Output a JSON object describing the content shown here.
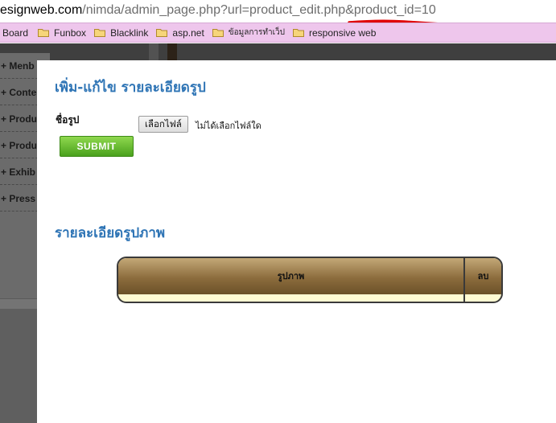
{
  "browser": {
    "url_host": "esignweb.com",
    "url_path": "/nimda/admin_page.php?url=product_edit.php&",
    "url_highlight": "product_id=10",
    "bookmarks": [
      {
        "label": "Board",
        "icon": "none"
      },
      {
        "label": "Funbox",
        "icon": "folder-icon"
      },
      {
        "label": "Blacklink",
        "icon": "folder-icon"
      },
      {
        "label": "asp.net",
        "icon": "folder-icon"
      },
      {
        "label": "ข้อมูลการทำเว็ป",
        "icon": "folder-icon"
      },
      {
        "label": "responsive web",
        "icon": "folder-icon"
      }
    ],
    "annotation_color": "#e00000"
  },
  "background_menu": {
    "items": [
      "+ Menb",
      "+ Conte",
      "+ Produ",
      "+ Produ",
      "+ Exhib",
      "+ Press"
    ]
  },
  "modal": {
    "title": "เพิ่ม-แก้ไข รายละเอียดรูป",
    "name_label": "ชื่อรูป",
    "file_button": "เลือกไฟล์",
    "file_status": "ไม่ได้เลือกไฟล์ใด",
    "submit_label": "SUBMIT",
    "section_title": "รายละเอียดรูปภาพ",
    "table": {
      "columns": [
        "รูปภาพ",
        "ลบ"
      ],
      "rows": []
    }
  },
  "colors": {
    "heading": "#2e74b5",
    "submit_green": "#5fb72a",
    "bookmarks_bar": "#eec6ec",
    "table_header": "#8c6c3d",
    "table_body": "#fffbd2"
  }
}
